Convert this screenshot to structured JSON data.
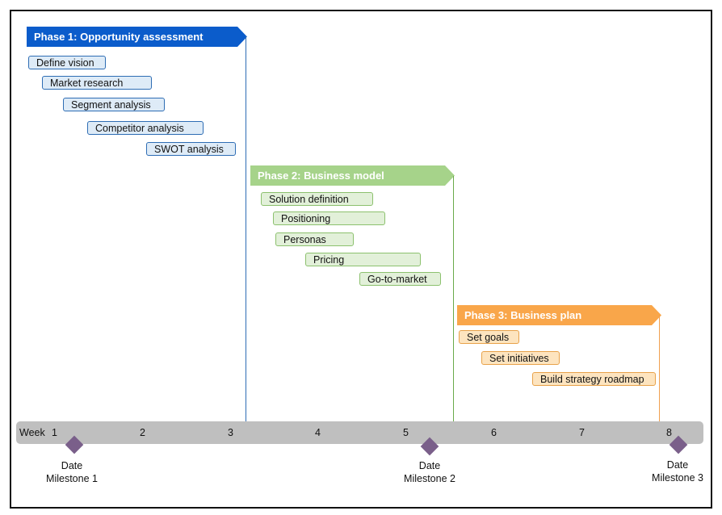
{
  "phases": [
    {
      "label": "Phase 1: Opportunity assessment",
      "color": "#0b5ccb",
      "tasks": [
        "Define vision",
        "Market research",
        "Segment analysis",
        "Competitor analysis",
        "SWOT analysis"
      ]
    },
    {
      "label": "Phase 2: Business model",
      "color": "#a6d38a",
      "tasks": [
        "Solution definition",
        "Positioning",
        "Personas",
        "Pricing",
        "Go-to-market"
      ]
    },
    {
      "label": "Phase 3: Business plan",
      "color": "#f9a64a",
      "tasks": [
        "Set goals",
        "Set initiatives",
        "Build strategy roadmap"
      ]
    }
  ],
  "timeline": {
    "label": "Week",
    "weeks": [
      "1",
      "2",
      "3",
      "4",
      "5",
      "6",
      "7",
      "8"
    ],
    "color": "#bfbfbf"
  },
  "milestones": [
    {
      "date": "Date",
      "label": "Milestone 1"
    },
    {
      "date": "Date",
      "label": "Milestone 2"
    },
    {
      "date": "Date",
      "label": "Milestone 3"
    }
  ],
  "milestone_color": "#7a5f8a"
}
